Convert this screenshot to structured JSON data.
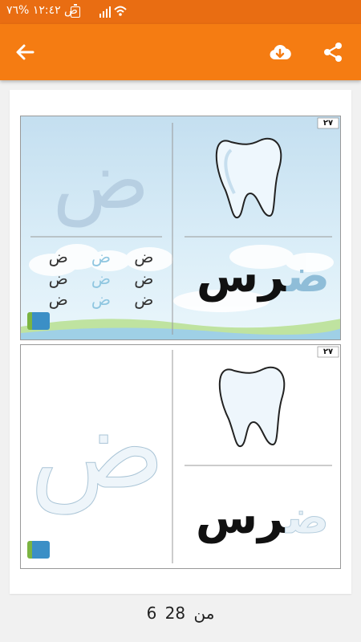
{
  "status_bar": {
    "text": "ص ١٢:٤٢ %٧٦"
  },
  "app_bar": {
    "back_icon": "arrow-left-icon",
    "download_icon": "cloud-download-icon",
    "share_icon": "share-icon"
  },
  "worksheet": {
    "letter": "ض",
    "word": "ضرس",
    "word_rest": "رس",
    "image_subject": "tooth-icon",
    "corner_badge": "٢٧"
  },
  "pager": {
    "current": "6",
    "separator": "من",
    "total": "28"
  },
  "colors": {
    "status_bar": "#e96d12",
    "app_bar": "#f57c12",
    "sky": "#cfe5f3",
    "letter_light": "#b7cfe2",
    "grass": "#bfe3a0"
  }
}
